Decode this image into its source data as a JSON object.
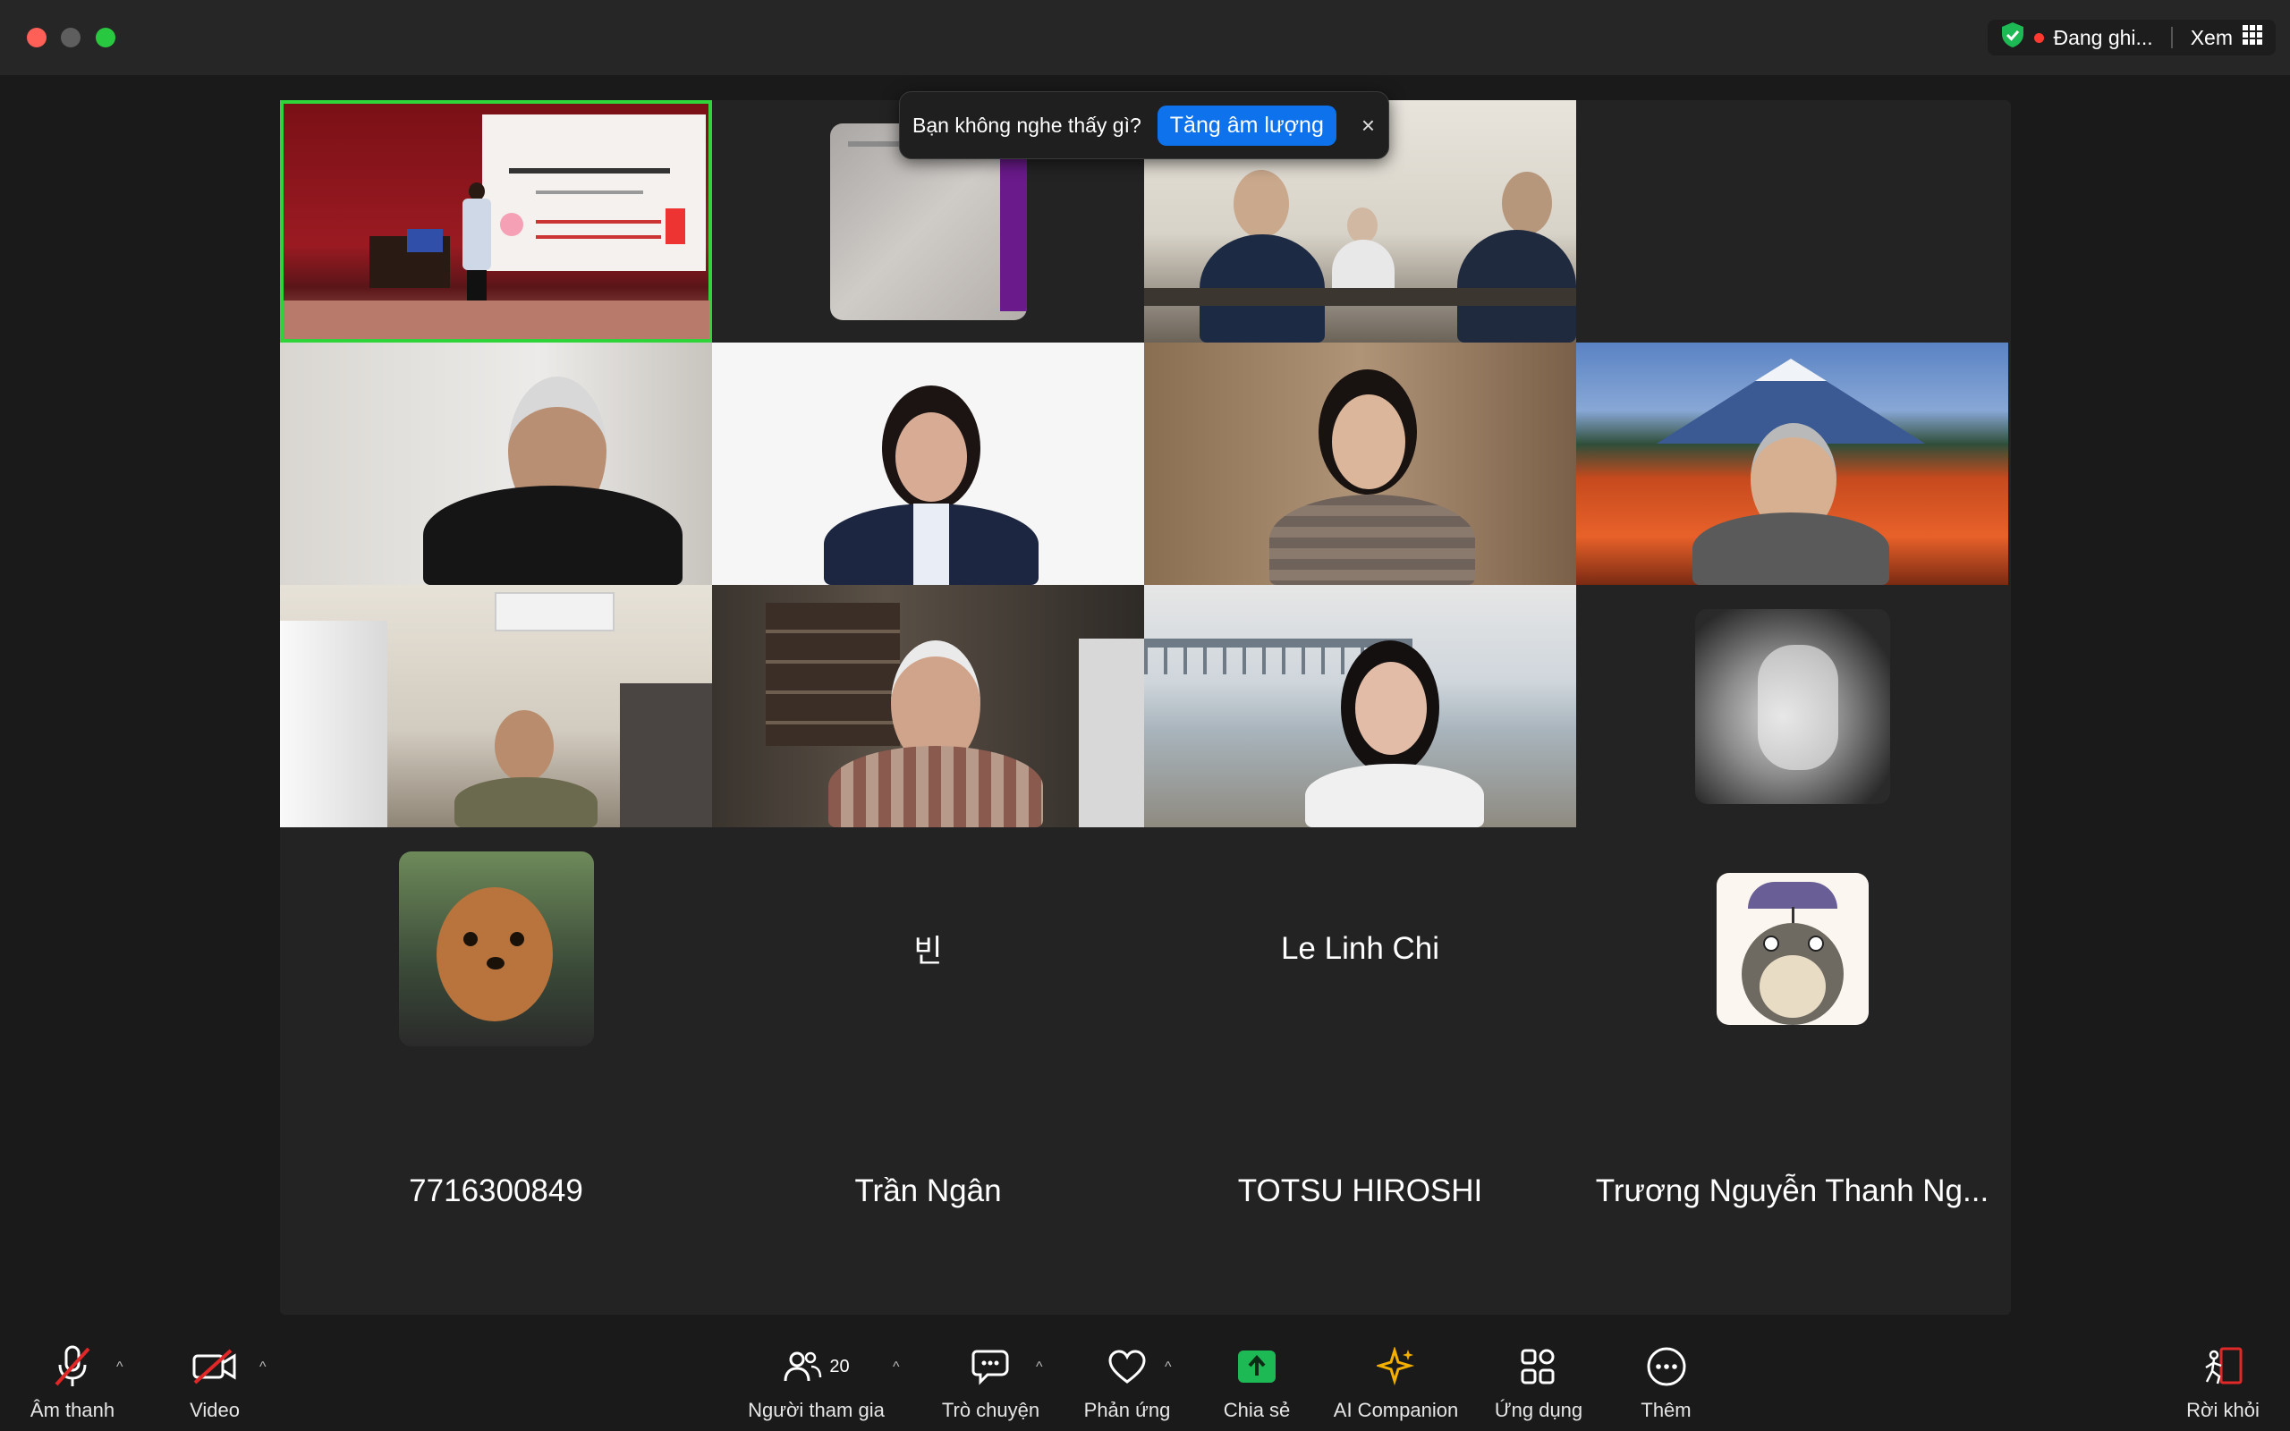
{
  "titlebar": {
    "recording": "Đang ghi...",
    "view_label": "Xem"
  },
  "popup": {
    "message": "Bạn không nghe thấy gì?",
    "button": "Tăng âm lượng",
    "close": "×"
  },
  "tiles": {
    "name_bin": "빈",
    "name_lelinhchi": "Le Linh Chi",
    "name_7716": "7716300849",
    "name_tranngan": "Trần Ngân",
    "name_totsu": "TOTSU HIROSHI",
    "name_truong": "Trương Nguyễn Thanh Ng..."
  },
  "toolbar": {
    "audio": "Âm thanh",
    "video": "Video",
    "participants": "Người tham gia",
    "participants_count": "20",
    "chat": "Trò chuyện",
    "react": "Phản ứng",
    "share": "Chia sẻ",
    "ai": "AI Companion",
    "apps": "Ứng dụng",
    "more": "Thêm",
    "leave": "Rời khỏi"
  },
  "colors": {
    "active_speaker": "#2fd43a",
    "share_green": "#1db954",
    "leave_red": "#e02828",
    "popup_button": "#0e72ed"
  }
}
